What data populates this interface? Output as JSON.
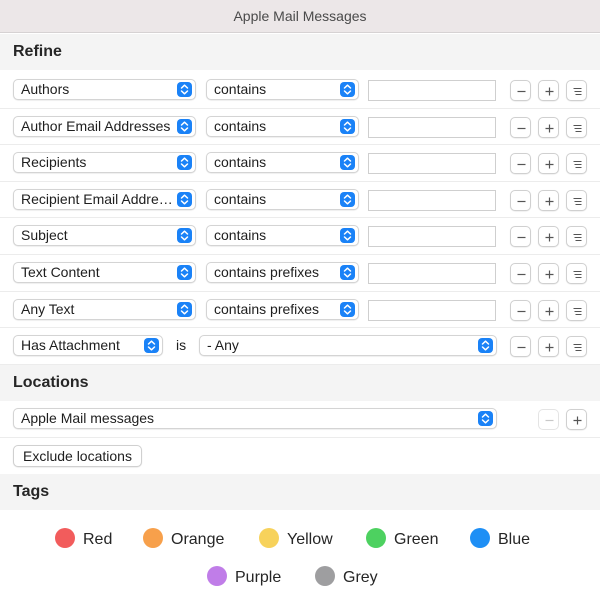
{
  "window": {
    "title": "Apple Mail Messages"
  },
  "sections": {
    "refine": "Refine",
    "locations": "Locations",
    "tags": "Tags"
  },
  "refine_rows": [
    {
      "field": "Authors",
      "operator": "contains",
      "value": ""
    },
    {
      "field": "Author Email Addresses",
      "operator": "contains",
      "value": ""
    },
    {
      "field": "Recipients",
      "operator": "contains",
      "value": ""
    },
    {
      "field": "Recipient Email Addresses",
      "operator": "contains",
      "value": ""
    },
    {
      "field": "Subject",
      "operator": "contains",
      "value": ""
    },
    {
      "field": "Text Content",
      "operator": "contains prefixes",
      "value": ""
    },
    {
      "field": "Any Text",
      "operator": "contains prefixes",
      "value": ""
    }
  ],
  "attachment_row": {
    "field": "Has Attachment",
    "connector": "is",
    "value": "- Any"
  },
  "locations": {
    "selected": "Apple Mail messages",
    "exclude_label": "Exclude locations"
  },
  "tags": [
    {
      "name": "Red",
      "color": "#f25c5c"
    },
    {
      "name": "Orange",
      "color": "#f7a04b"
    },
    {
      "name": "Yellow",
      "color": "#f7d25b"
    },
    {
      "name": "Green",
      "color": "#4dd160"
    },
    {
      "name": "Blue",
      "color": "#1e8ff5"
    },
    {
      "name": "Purple",
      "color": "#c07de8"
    },
    {
      "name": "Grey",
      "color": "#9e9ea0"
    }
  ],
  "icons": {
    "popup_chevron": "chevron-up-down-icon",
    "remove": "minus-icon",
    "add": "plus-icon",
    "options": "list-lines-icon"
  }
}
